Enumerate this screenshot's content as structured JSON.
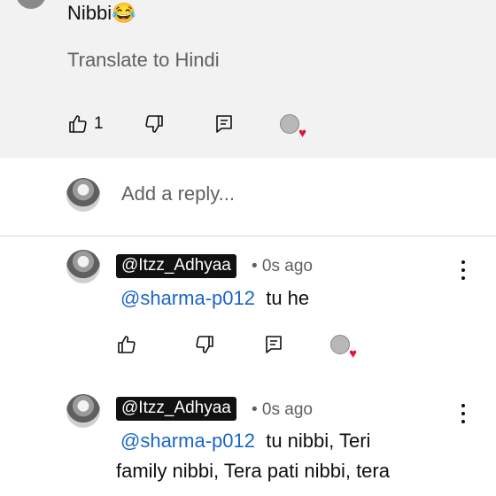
{
  "comment": {
    "text": "Nibbi😂",
    "translate_label": "Translate to Hindi",
    "like_count": "1"
  },
  "reply_input": {
    "placeholder": "Add a reply..."
  },
  "replies": [
    {
      "handle": "@Itzz_Adhyaa",
      "time": "• 0s ago",
      "mention": "@sharma-p012",
      "text_line1": "tu he",
      "text_line2": ""
    },
    {
      "handle": "@Itzz_Adhyaa",
      "time": "• 0s ago",
      "mention": "@sharma-p012",
      "text_line1": "tu nibbi,  Teri",
      "text_line2": "family nibbi,  Tera pati nibbi,  tera"
    }
  ],
  "icons": {
    "like": "thumbs-up-icon",
    "dislike": "thumbs-down-icon",
    "reply": "comment-icon",
    "heart": "creator-heart-icon",
    "more": "more-vertical-icon"
  },
  "colors": {
    "mention": "#1a66c5",
    "heart": "#e0143c",
    "comment_bg": "#f2f2f2",
    "handle_bg": "#111111"
  }
}
